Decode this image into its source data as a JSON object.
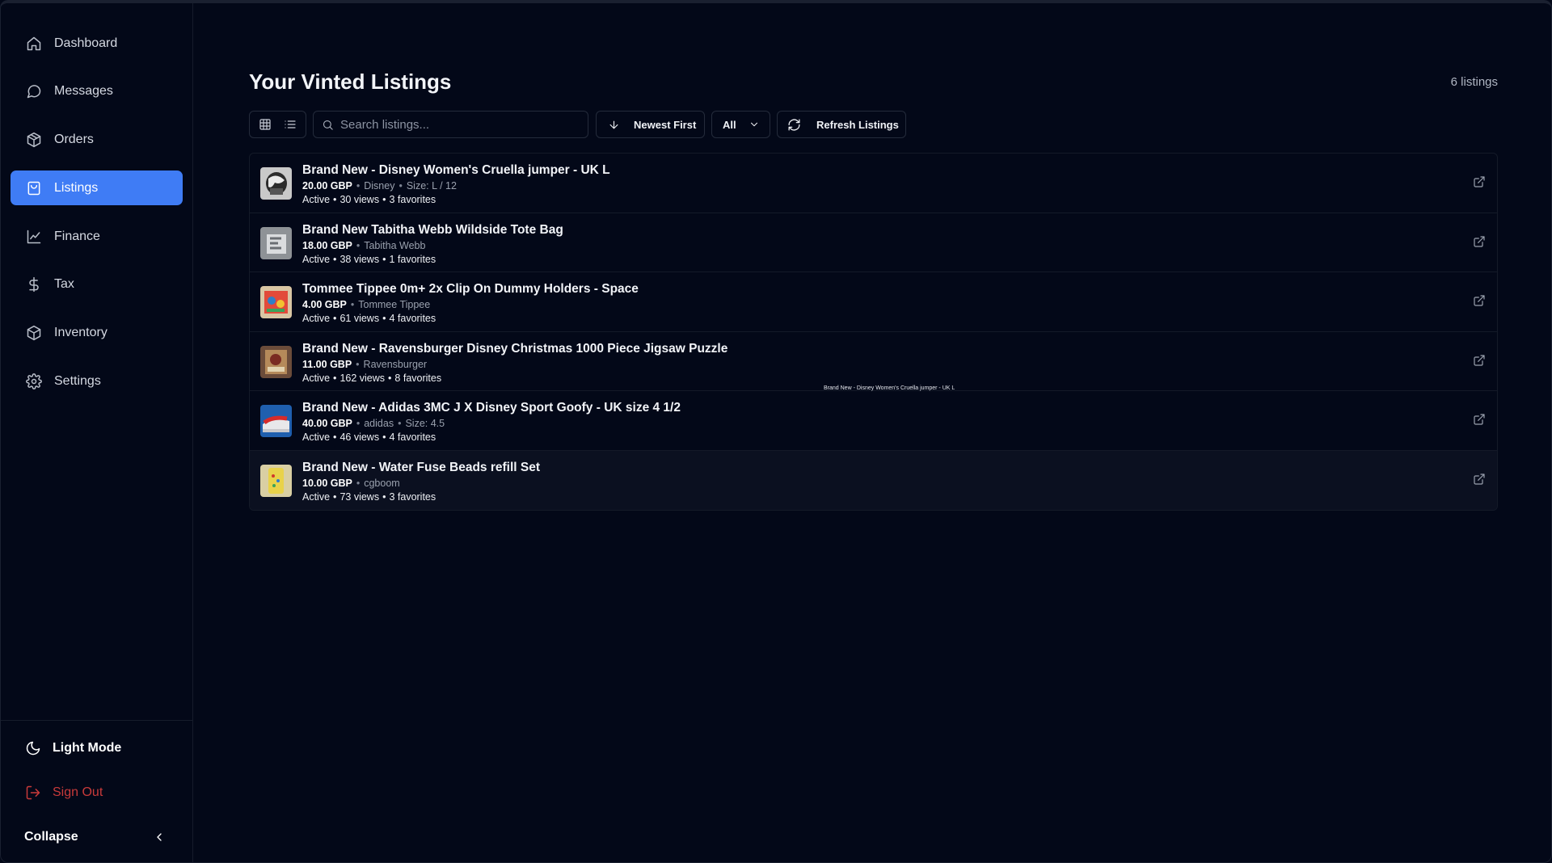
{
  "sidebar": {
    "items": [
      {
        "label": "Dashboard",
        "icon": "home-icon",
        "active": false
      },
      {
        "label": "Messages",
        "icon": "message-icon",
        "active": false
      },
      {
        "label": "Orders",
        "icon": "package-icon",
        "active": false
      },
      {
        "label": "Listings",
        "icon": "shopping-bag-icon",
        "active": true
      },
      {
        "label": "Finance",
        "icon": "line-chart-icon",
        "active": false
      },
      {
        "label": "Tax",
        "icon": "dollar-icon",
        "active": false
      },
      {
        "label": "Inventory",
        "icon": "box-icon",
        "active": false
      },
      {
        "label": "Settings",
        "icon": "gear-icon",
        "active": false
      }
    ],
    "light_mode_label": "Light Mode",
    "sign_out_label": "Sign Out",
    "collapse_label": "Collapse"
  },
  "page": {
    "title": "Your Vinted Listings",
    "count_label": "6 listings"
  },
  "toolbar": {
    "search_placeholder": "Search listings...",
    "sort_label": "Newest First",
    "filter_label": "All",
    "refresh_label": "Refresh Listings"
  },
  "listings": [
    {
      "title": "Brand New - Disney Women's Cruella jumper - UK L",
      "price": "20.00 GBP",
      "brand": "Disney",
      "size": "Size: L / 12",
      "status": "Active",
      "views": "30 views",
      "favorites": "3 favorites"
    },
    {
      "title": "Brand New Tabitha Webb Wildside Tote Bag",
      "price": "18.00 GBP",
      "brand": "Tabitha Webb",
      "size": "",
      "status": "Active",
      "views": "38 views",
      "favorites": "1 favorites"
    },
    {
      "title": "Tommee Tippee 0m+ 2x Clip On Dummy Holders - Space",
      "price": "4.00 GBP",
      "brand": "Tommee Tippee",
      "size": "",
      "status": "Active",
      "views": "61 views",
      "favorites": "4 favorites"
    },
    {
      "title": "Brand New - Ravensburger Disney Christmas 1000 Piece Jigsaw Puzzle",
      "price": "11.00 GBP",
      "brand": "Ravensburger",
      "size": "",
      "status": "Active",
      "views": "162 views",
      "favorites": "8 favorites"
    },
    {
      "title": "Brand New - Adidas 3MC J X Disney Sport Goofy - UK size 4 1/2",
      "price": "40.00 GBP",
      "brand": "adidas",
      "size": "Size: 4.5",
      "status": "Active",
      "views": "46 views",
      "favorites": "4 favorites"
    },
    {
      "title": "Brand New - Water Fuse Beads refill Set",
      "price": "10.00 GBP",
      "brand": "cgboom",
      "size": "",
      "status": "Active",
      "views": "73 views",
      "favorites": "3 favorites"
    }
  ],
  "tooltip": "Brand New - Disney Women's Cruella jumper - UK L",
  "colors": {
    "background": "#030818",
    "accent": "#3f7cf5",
    "danger": "#c93a3a"
  }
}
